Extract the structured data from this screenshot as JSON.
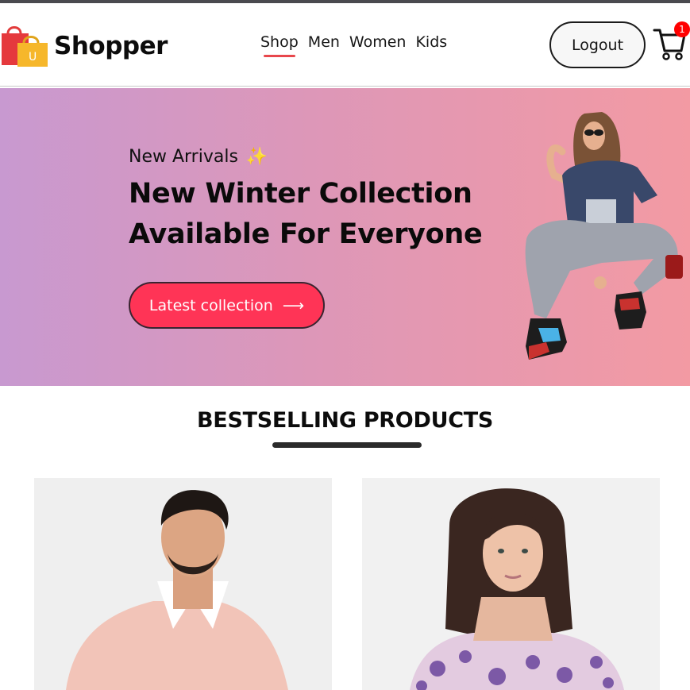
{
  "header": {
    "brand": "Shopper",
    "nav": [
      "Shop",
      "Men",
      "Women",
      "Kids"
    ],
    "active_nav": "Shop",
    "logout_label": "Logout",
    "cart_count": "1"
  },
  "hero": {
    "subtitle": "New Arrivals",
    "title_line1": "New Winter Collection",
    "title_line2": "Available For Everyone",
    "button_label": "Latest collection",
    "button_arrow": "⟶"
  },
  "section": {
    "title": "BESTSELLING PRODUCTS"
  },
  "colors": {
    "accent": "#ff3456",
    "nav_underline": "#e8474c",
    "badge": "#ff0000",
    "hero_gradient_start": "#c899d0",
    "hero_gradient_end": "#f39aa3"
  },
  "icons": {
    "logo": "shopping-bag-icon",
    "cart": "cart-icon",
    "sparkle": "sparkle-icon",
    "arrow": "arrow-right-icon"
  }
}
